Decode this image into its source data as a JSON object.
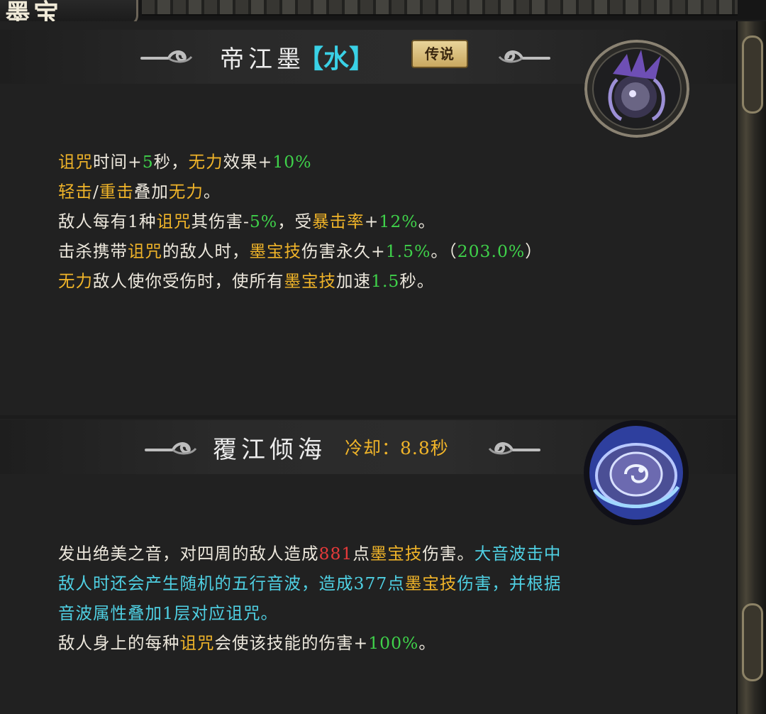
{
  "header": {
    "tab_title": "墨宝"
  },
  "colors": {
    "highlight": "#f0b429",
    "bonus": "#3fd14a",
    "damage": "#e53a3a",
    "water": "#4fd0e3"
  },
  "treasure": {
    "name": "帝江墨",
    "element": "【水】",
    "rarity_badge": "传说",
    "icon": "dijiang-ink-treasure-icon",
    "lines": [
      [
        [
          "y",
          "诅咒"
        ],
        [
          "w",
          "时间+"
        ],
        [
          "g",
          "5"
        ],
        [
          "w",
          "秒，"
        ],
        [
          "y",
          "无力"
        ],
        [
          "w",
          "效果+"
        ],
        [
          "g",
          "10%"
        ]
      ],
      [
        [
          "y",
          "轻击"
        ],
        [
          "w",
          "/"
        ],
        [
          "y",
          "重击"
        ],
        [
          "w",
          "叠加"
        ],
        [
          "y",
          "无力"
        ],
        [
          "w",
          "。"
        ]
      ],
      [
        [
          "w",
          "敌人每有1种"
        ],
        [
          "y",
          "诅咒"
        ],
        [
          "w",
          "其伤害-"
        ],
        [
          "g",
          "5%"
        ],
        [
          "w",
          "，受"
        ],
        [
          "y",
          "暴击率"
        ],
        [
          "w",
          "+"
        ],
        [
          "g",
          "12%"
        ],
        [
          "w",
          "。"
        ]
      ],
      [
        [
          "w",
          "击杀携带"
        ],
        [
          "y",
          "诅咒"
        ],
        [
          "w",
          "的敌人时，"
        ],
        [
          "y",
          "墨宝技"
        ],
        [
          "w",
          "伤害永久+"
        ],
        [
          "g",
          "1.5%"
        ],
        [
          "w",
          "。（"
        ],
        [
          "g",
          "203.0%"
        ],
        [
          "w",
          "）"
        ]
      ],
      [
        [
          "y",
          "无力"
        ],
        [
          "w",
          "敌人使你受伤时，使所有"
        ],
        [
          "y",
          "墨宝技"
        ],
        [
          "w",
          "加速"
        ],
        [
          "g",
          "1.5"
        ],
        [
          "w",
          "秒。"
        ]
      ]
    ]
  },
  "skill": {
    "name": "覆江倾海",
    "cooldown": "冷却：8.8秒",
    "icon": "water-vortex-skill-icon",
    "lines": [
      [
        [
          "w",
          "发出绝美之音，对四周的敌人造成"
        ],
        [
          "r",
          "881"
        ],
        [
          "w",
          "点"
        ],
        [
          "y",
          "墨宝技"
        ],
        [
          "w",
          "伤害。"
        ],
        [
          "c",
          "大音波击中"
        ]
      ],
      [
        [
          "c",
          "敌人时还会产生随机的五行音波，造成377点"
        ],
        [
          "y",
          "墨宝技"
        ],
        [
          "c",
          "伤害，并根据"
        ]
      ],
      [
        [
          "c",
          "音波属性叠加1层对应诅咒。"
        ]
      ],
      [
        [
          "w",
          "敌人身上的每种"
        ],
        [
          "y",
          "诅咒"
        ],
        [
          "w",
          "会使该技能的伤害+"
        ],
        [
          "g",
          "100%"
        ],
        [
          "w",
          "。"
        ]
      ]
    ]
  }
}
